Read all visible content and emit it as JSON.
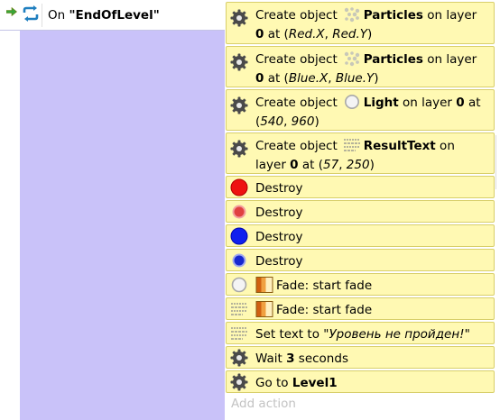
{
  "event": {
    "label_prefix": "On ",
    "name": "\"EndOfLevel\""
  },
  "actions": [
    {
      "kind": "create",
      "icon": "gear-icon",
      "p1": "Create object",
      "object_icon": "particles-icon",
      "object": "Particles",
      "mid": " on layer ",
      "layer": "0",
      "p2": " at (",
      "x": "Red.X",
      "sep": ", ",
      "y": "Red.Y",
      "end": ")"
    },
    {
      "kind": "create",
      "icon": "gear-icon",
      "p1": "Create object",
      "object_icon": "particles-icon",
      "object": "Particles",
      "mid": " on layer ",
      "layer": "0",
      "p2": " at (",
      "x": "Blue.X",
      "sep": ", ",
      "y": "Blue.Y",
      "end": ")"
    },
    {
      "kind": "create",
      "icon": "gear-icon",
      "p1": "Create object",
      "object_icon": "light-icon",
      "object": "Light",
      "mid": " on layer ",
      "layer": "0",
      "p2": " at (",
      "x": "540",
      "sep": ", ",
      "y": "960",
      "end": ")"
    },
    {
      "kind": "create",
      "icon": "gear-icon",
      "p1": "Create object",
      "object_icon": "text-object-icon",
      "object": "ResultText",
      "mid": " on layer ",
      "layer": "0",
      "p2": " at (",
      "x": "57",
      "sep": ", ",
      "y": "250",
      "end": ")"
    },
    {
      "kind": "simple",
      "icon": "red-circle-icon",
      "text": "Destroy"
    },
    {
      "kind": "simple",
      "icon": "red-particle-icon",
      "text": "Destroy"
    },
    {
      "kind": "simple",
      "icon": "blue-circle-icon",
      "text": "Destroy"
    },
    {
      "kind": "simple",
      "icon": "blue-particle-icon",
      "text": "Destroy"
    },
    {
      "kind": "fade",
      "icon": "light-icon",
      "text": "Fade: start fade"
    },
    {
      "kind": "fade",
      "icon": "text-object-icon",
      "text": "Fade: start fade"
    },
    {
      "kind": "settext",
      "icon": "text-object-icon",
      "text": "Set text to ",
      "value": "\"Уровень не пройден!\""
    },
    {
      "kind": "wait",
      "icon": "gear-icon",
      "text": "Wait ",
      "value": "3",
      "suffix": " seconds"
    },
    {
      "kind": "goto",
      "icon": "gear-icon",
      "text": "Go to ",
      "value": "Level1"
    }
  ],
  "add_action": "Add action",
  "colors": {
    "condition_column": "#c9c2f9",
    "action_bg": "#fff9b3",
    "action_border": "#d8cf6a"
  }
}
